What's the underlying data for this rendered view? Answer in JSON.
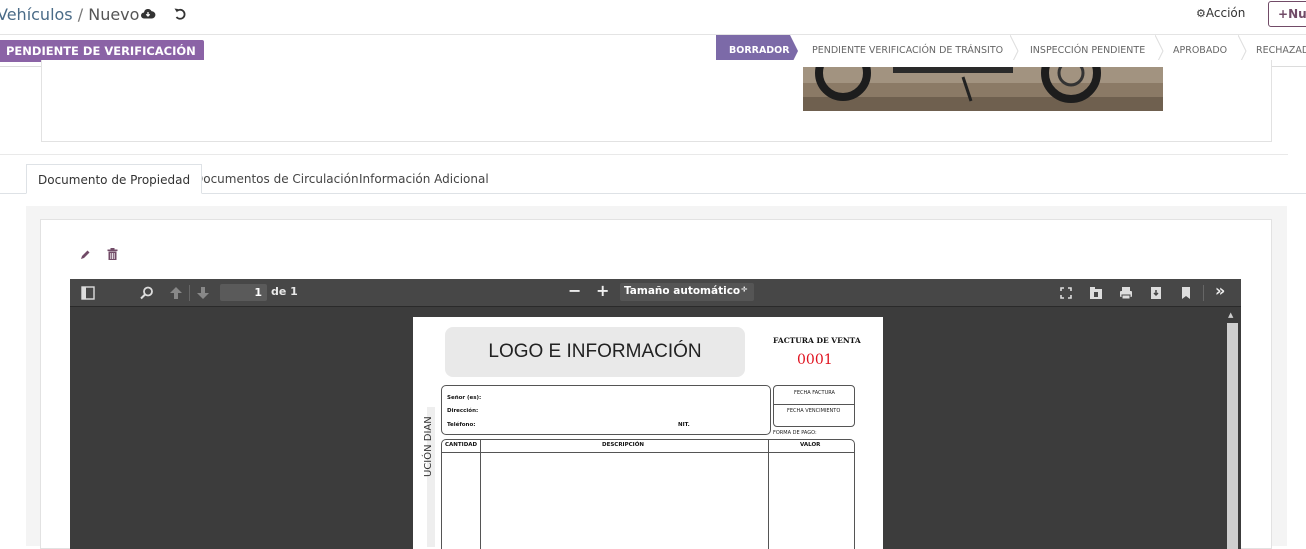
{
  "breadcrumb": {
    "parent": "Vehículos",
    "separator": "/",
    "current": "Nuevo"
  },
  "header": {
    "action_label": "Acción",
    "new_label": "Nu"
  },
  "status_badge": "PENDIENTE DE VERIFICACIÓN",
  "stages": [
    {
      "label": "BORRADOR",
      "active": true
    },
    {
      "label": "PENDIENTE VERIFICACIÓN DE TRÁNSITO",
      "active": false
    },
    {
      "label": "INSPECCIÓN PENDIENTE",
      "active": false
    },
    {
      "label": "APROBADO",
      "active": false
    },
    {
      "label": "RECHAZAD",
      "active": false
    }
  ],
  "tabs": [
    {
      "label": "Documento de Propiedad",
      "active": true
    },
    {
      "label": "Documentos de Circulación",
      "active": false
    },
    {
      "label": "Información Adicional",
      "active": false
    }
  ],
  "viewer": {
    "page_number": "1",
    "of_pages": "de 1",
    "zoom": "Tamaño automático",
    "zoom_arrow": "÷"
  },
  "document": {
    "logo_text": "LOGO E INFORMACIÓN",
    "invoice_label": "FACTURA DE VENTA",
    "invoice_number": "0001",
    "senor": "Señor (es):",
    "direccion": "Dirección:",
    "telefono": "Teléfono:",
    "nit": "NIT.",
    "fecha_factura": "FECHA FACTURA",
    "fecha_vencimiento": "FECHA VENCIMIENTO",
    "forma_pago": "FORMA DE PAGO:",
    "col_cantidad": "CANTIDAD",
    "col_descripcion": "DESCRIPCIÓN",
    "col_valor": "VALOR",
    "side_text": "UCIÓN DIAN"
  },
  "colors": {
    "primary": "#714b67",
    "badge": "#8b63a6",
    "active_stage": "#7c6aa8",
    "invoice_number": "#e0121f",
    "viewer_bg": "#3c3c3c"
  }
}
